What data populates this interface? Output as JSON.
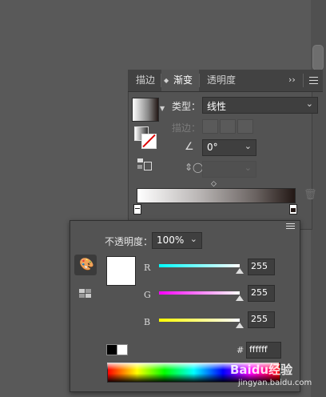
{
  "tabs": [
    {
      "label": "描边",
      "active": false
    },
    {
      "label": "渐变",
      "active": true
    },
    {
      "label": "透明度",
      "active": false
    }
  ],
  "gradient_panel": {
    "type_label": "类型：",
    "type_value": "线性",
    "stroke_label": "描边：",
    "angle_value": "0°",
    "aspect_value": "",
    "start_color": "#ffffff",
    "end_color": "#231815"
  },
  "color_picker": {
    "opacity_label": "不透明度：",
    "opacity_value": "100%",
    "channels": [
      {
        "name": "R",
        "value": "255",
        "color": "#00ffff",
        "level": 1.0
      },
      {
        "name": "G",
        "value": "255",
        "color": "#ff00ff",
        "level": 1.0
      },
      {
        "name": "B",
        "value": "255",
        "color": "#ffff00",
        "level": 1.0
      }
    ],
    "hex_prefix": "#",
    "hex_value": "ffffff",
    "current_color": "#ffffff"
  },
  "watermark": {
    "text": "Baidu经验",
    "url": "jingyan.baidu.com"
  },
  "colors": {
    "panel_bg": "#535353",
    "canvas_bg": "#595959",
    "tab_bar": "#424242"
  }
}
